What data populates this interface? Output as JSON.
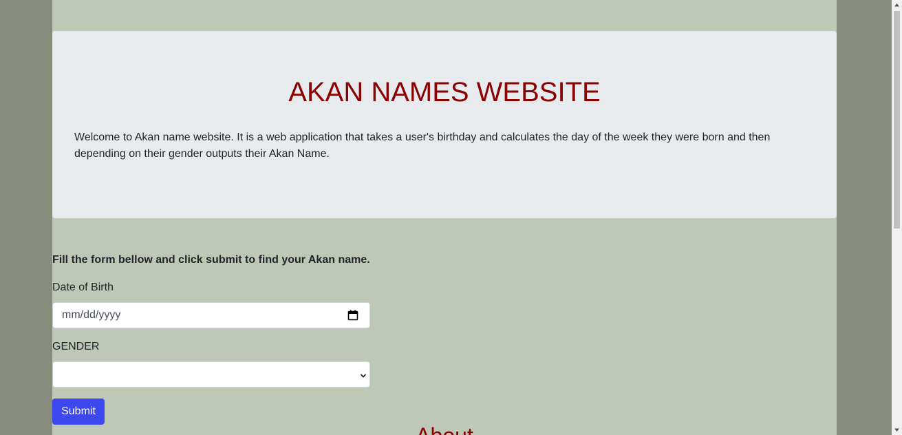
{
  "header": {
    "title": "AKAN NAMES WEBSITE",
    "description": "Welcome to Akan name website. It is a web application that takes a user's birthday and calculates the day of the week they were born and then depending on their gender outputs their Akan Name."
  },
  "form": {
    "intro": "Fill the form bellow and click submit to find your Akan name.",
    "dob_label": "Date of Birth",
    "dob_placeholder": "mm/dd/yyyy",
    "gender_label": "GENDER",
    "gender_selected": "",
    "submit_label": "Submit"
  },
  "about": {
    "title": "About"
  },
  "colors": {
    "page_bg": "#878c7d",
    "container_bg": "#bfc8b6",
    "jumbotron_bg": "#e8ebee",
    "title_color": "#8b0000",
    "button_bg": "#3c47f0"
  },
  "icons": {
    "date_picker": "calendar-icon",
    "select": "chevron-down-icon"
  }
}
